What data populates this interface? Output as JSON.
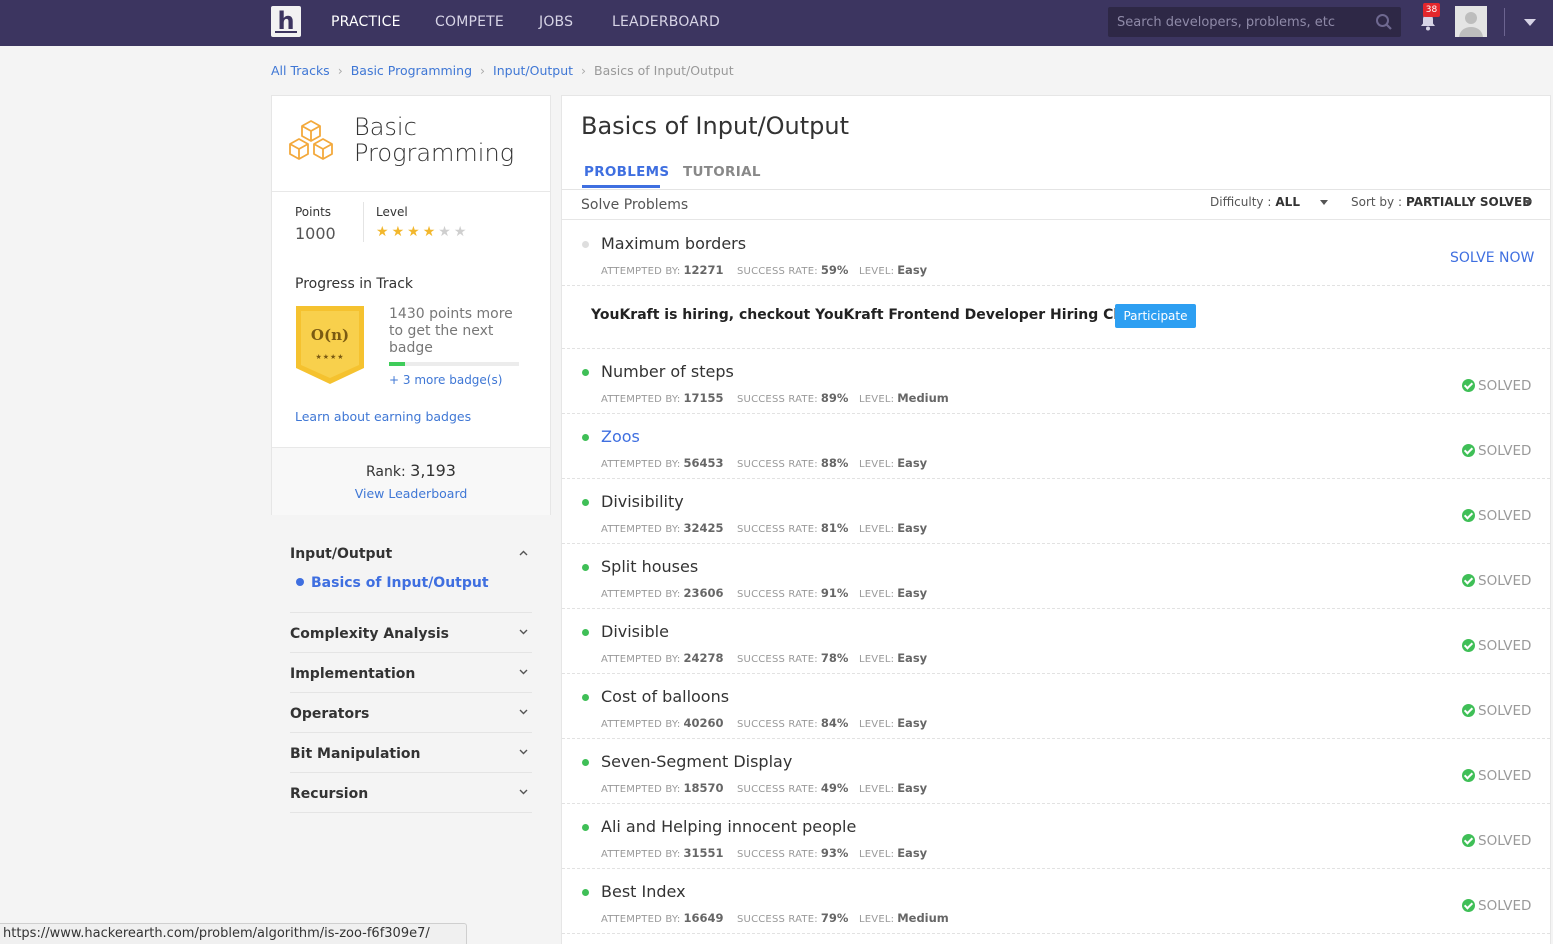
{
  "nav": {
    "logo_letter": "h",
    "items": [
      "PRACTICE",
      "COMPETE",
      "JOBS",
      "LEADERBOARD"
    ],
    "search_placeholder": "Search developers, problems, etc",
    "notification_count": "38"
  },
  "breadcrumb": [
    "All Tracks",
    "Basic Programming",
    "Input/Output",
    "Basics of Input/Output"
  ],
  "track": {
    "title_line1": "Basic",
    "title_line2": "Programming",
    "points_label": "Points",
    "points_value": "1000",
    "level_label": "Level",
    "level_stars_filled": 4,
    "level_stars_total": 6,
    "progress_title": "Progress in Track",
    "badge_text": "O(n)",
    "badge_stars": "★★★★",
    "badge_message": "1430 points more to get the next badge",
    "badge_progress": 0.12,
    "more_badges": "+ 3 more badge(s)",
    "learn_link": "Learn about earning badges",
    "rank_label": "Rank:",
    "rank_value": "3,193",
    "leaderboard_link": "View Leaderboard"
  },
  "topics": [
    {
      "label": "Input/Output",
      "open": true,
      "sub": "Basics of Input/Output"
    },
    {
      "label": "Complexity Analysis"
    },
    {
      "label": "Implementation"
    },
    {
      "label": "Operators"
    },
    {
      "label": "Bit Manipulation"
    },
    {
      "label": "Recursion"
    }
  ],
  "main": {
    "title": "Basics of Input/Output",
    "tabs": [
      "PROBLEMS",
      "TUTORIAL"
    ],
    "solve_label": "Solve Problems",
    "difficulty_label": "Difficulty :",
    "difficulty_value": "ALL",
    "sort_label": "Sort by :",
    "sort_value": "PARTIALLY SOLVED",
    "meta_labels": {
      "attempted": "ATTEMPTED BY:",
      "success": "SUCCESS RATE:",
      "level": "LEVEL:"
    },
    "solve_now": "SOLVE NOW",
    "solved_label": "SOLVED",
    "hiring_text": "YouKraft is hiring, checkout YouKraft Frontend Developer Hiring Challenge",
    "participate": "Participate",
    "problems": [
      {
        "name": "Maximum borders",
        "attempted": "12271",
        "success": "59%",
        "level": "Easy",
        "status": "unsolved"
      },
      {
        "name": "Number of steps",
        "attempted": "17155",
        "success": "89%",
        "level": "Medium",
        "status": "solved"
      },
      {
        "name": "Zoos",
        "attempted": "56453",
        "success": "88%",
        "level": "Easy",
        "status": "solved",
        "hover": true
      },
      {
        "name": "Divisibility",
        "attempted": "32425",
        "success": "81%",
        "level": "Easy",
        "status": "solved"
      },
      {
        "name": "Split houses",
        "attempted": "23606",
        "success": "91%",
        "level": "Easy",
        "status": "solved"
      },
      {
        "name": "Divisible",
        "attempted": "24278",
        "success": "78%",
        "level": "Easy",
        "status": "solved"
      },
      {
        "name": "Cost of balloons",
        "attempted": "40260",
        "success": "84%",
        "level": "Easy",
        "status": "solved"
      },
      {
        "name": "Seven-Segment Display",
        "attempted": "18570",
        "success": "49%",
        "level": "Easy",
        "status": "solved"
      },
      {
        "name": "Ali and Helping innocent people",
        "attempted": "31551",
        "success": "93%",
        "level": "Easy",
        "status": "solved"
      },
      {
        "name": "Best Index",
        "attempted": "16649",
        "success": "79%",
        "level": "Medium",
        "status": "solved"
      }
    ]
  },
  "statusbar": "https://www.hackerearth.com/problem/algorithm/is-zoo-f6f309e7/",
  "colors": {
    "nav_bg": "#3c3560",
    "link": "#3f6fe0",
    "solved_green": "#3fbf57",
    "star": "#f2b72d",
    "badge_gold": "#f5c22f"
  }
}
